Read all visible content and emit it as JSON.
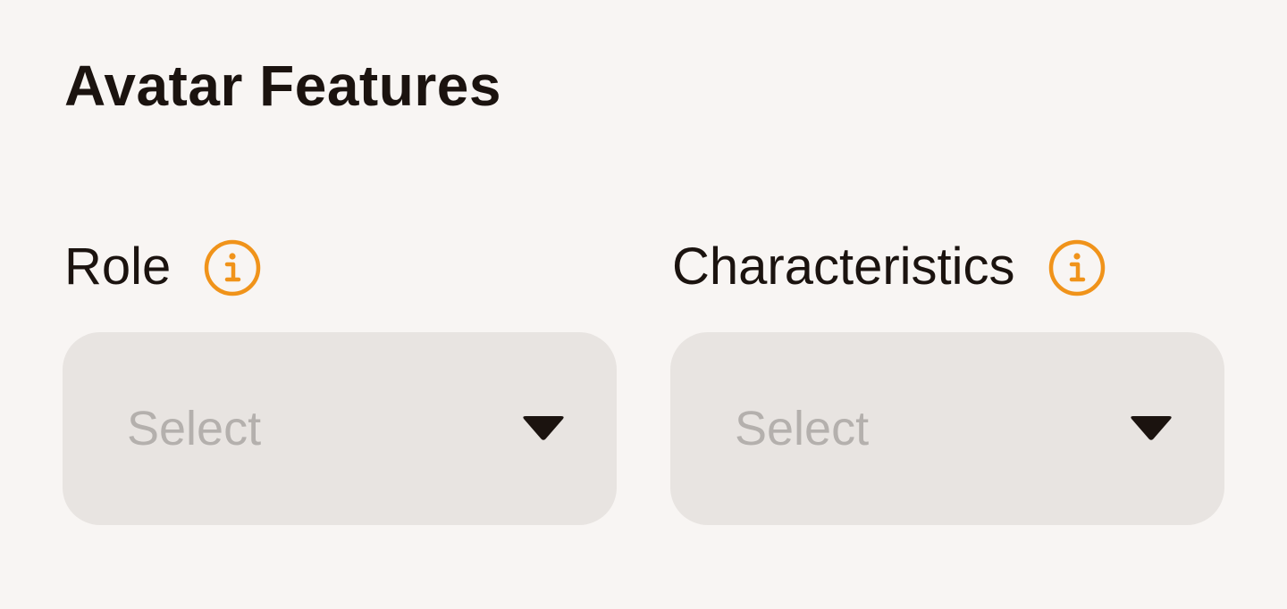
{
  "section": {
    "title": "Avatar Features"
  },
  "fields": [
    {
      "label": "Role",
      "info_icon": "info-circle-icon",
      "select": {
        "placeholder": "Select",
        "caret_icon": "caret-down-icon"
      }
    },
    {
      "label": "Characteristics",
      "info_icon": "info-circle-icon",
      "select": {
        "placeholder": "Select",
        "caret_icon": "caret-down-icon"
      }
    }
  ],
  "colors": {
    "background": "#f8f5f3",
    "text": "#1b130f",
    "accent": "#f0931a",
    "select_background": "#e8e4e1",
    "placeholder": "#b4b0ad"
  }
}
